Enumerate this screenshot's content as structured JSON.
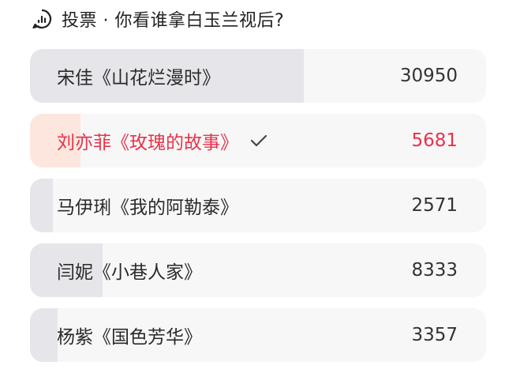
{
  "header": {
    "title": "投票 · 你看谁拿白玉兰视后?",
    "icon": "poll-chart-icon"
  },
  "colors": {
    "bar_fill": "#e6e6ea",
    "selected_fill": "#fde6de",
    "selected_text": "#e8334a"
  },
  "options": [
    {
      "label": "宋佳《山花烂漫时》",
      "count": "30950",
      "share": 0.6,
      "selected": false
    },
    {
      "label": "刘亦菲《玫瑰的故事》",
      "count": "5681",
      "share": 0.11,
      "selected": true
    },
    {
      "label": "马伊琍《我的阿勒泰》",
      "count": "2571",
      "share": 0.05,
      "selected": false
    },
    {
      "label": "闫妮《小巷人家》",
      "count": "8333",
      "share": 0.16,
      "selected": false
    },
    {
      "label": "杨紫《国色芳华》",
      "count": "3357",
      "share": 0.06,
      "selected": false
    }
  ]
}
